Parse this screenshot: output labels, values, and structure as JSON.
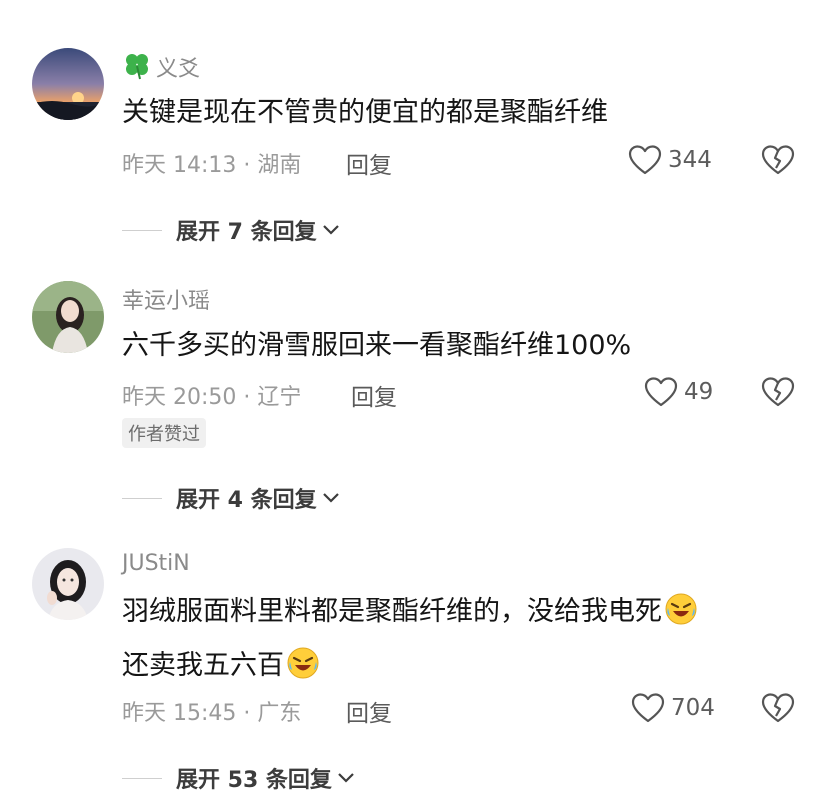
{
  "comments": [
    {
      "username": "义爻",
      "username_prefix_icon": "four-leaf-clover",
      "text_lines": [
        "关键是现在不管贵的便宜的都是聚酯纤维"
      ],
      "meta": "昨天 14:13 · 湖南",
      "reply_label": "回复",
      "likes": "344",
      "badge": "",
      "expand_label": "展开 7 条回复"
    },
    {
      "username": "幸运小瑶",
      "text_lines": [
        "六千多买的滑雪服回来一看聚酯纤维100%"
      ],
      "meta": "昨天 20:50 · 辽宁",
      "reply_label": "回复",
      "likes": "49",
      "badge": "作者赞过",
      "expand_label": "展开 4 条回复"
    },
    {
      "username": "JUStiN",
      "text_lines": [
        "羽绒服面料里料都是聚酯纤维的，没给我电死",
        "还卖我五六百"
      ],
      "meta": "昨天 15:45 · 广东",
      "reply_label": "回复",
      "likes": "704",
      "badge": "",
      "expand_label": "展开 53 条回复"
    }
  ],
  "icons": {
    "like": "heart-outline-icon",
    "dislike": "broken-heart-icon",
    "expand": "chevron-down-icon",
    "emoji": "laughing-crying-emoji"
  },
  "colors": {
    "text": "#151515",
    "meta": "#9a9a9a",
    "username": "#8a8a8a",
    "badge_bg": "#f0f0f0"
  }
}
